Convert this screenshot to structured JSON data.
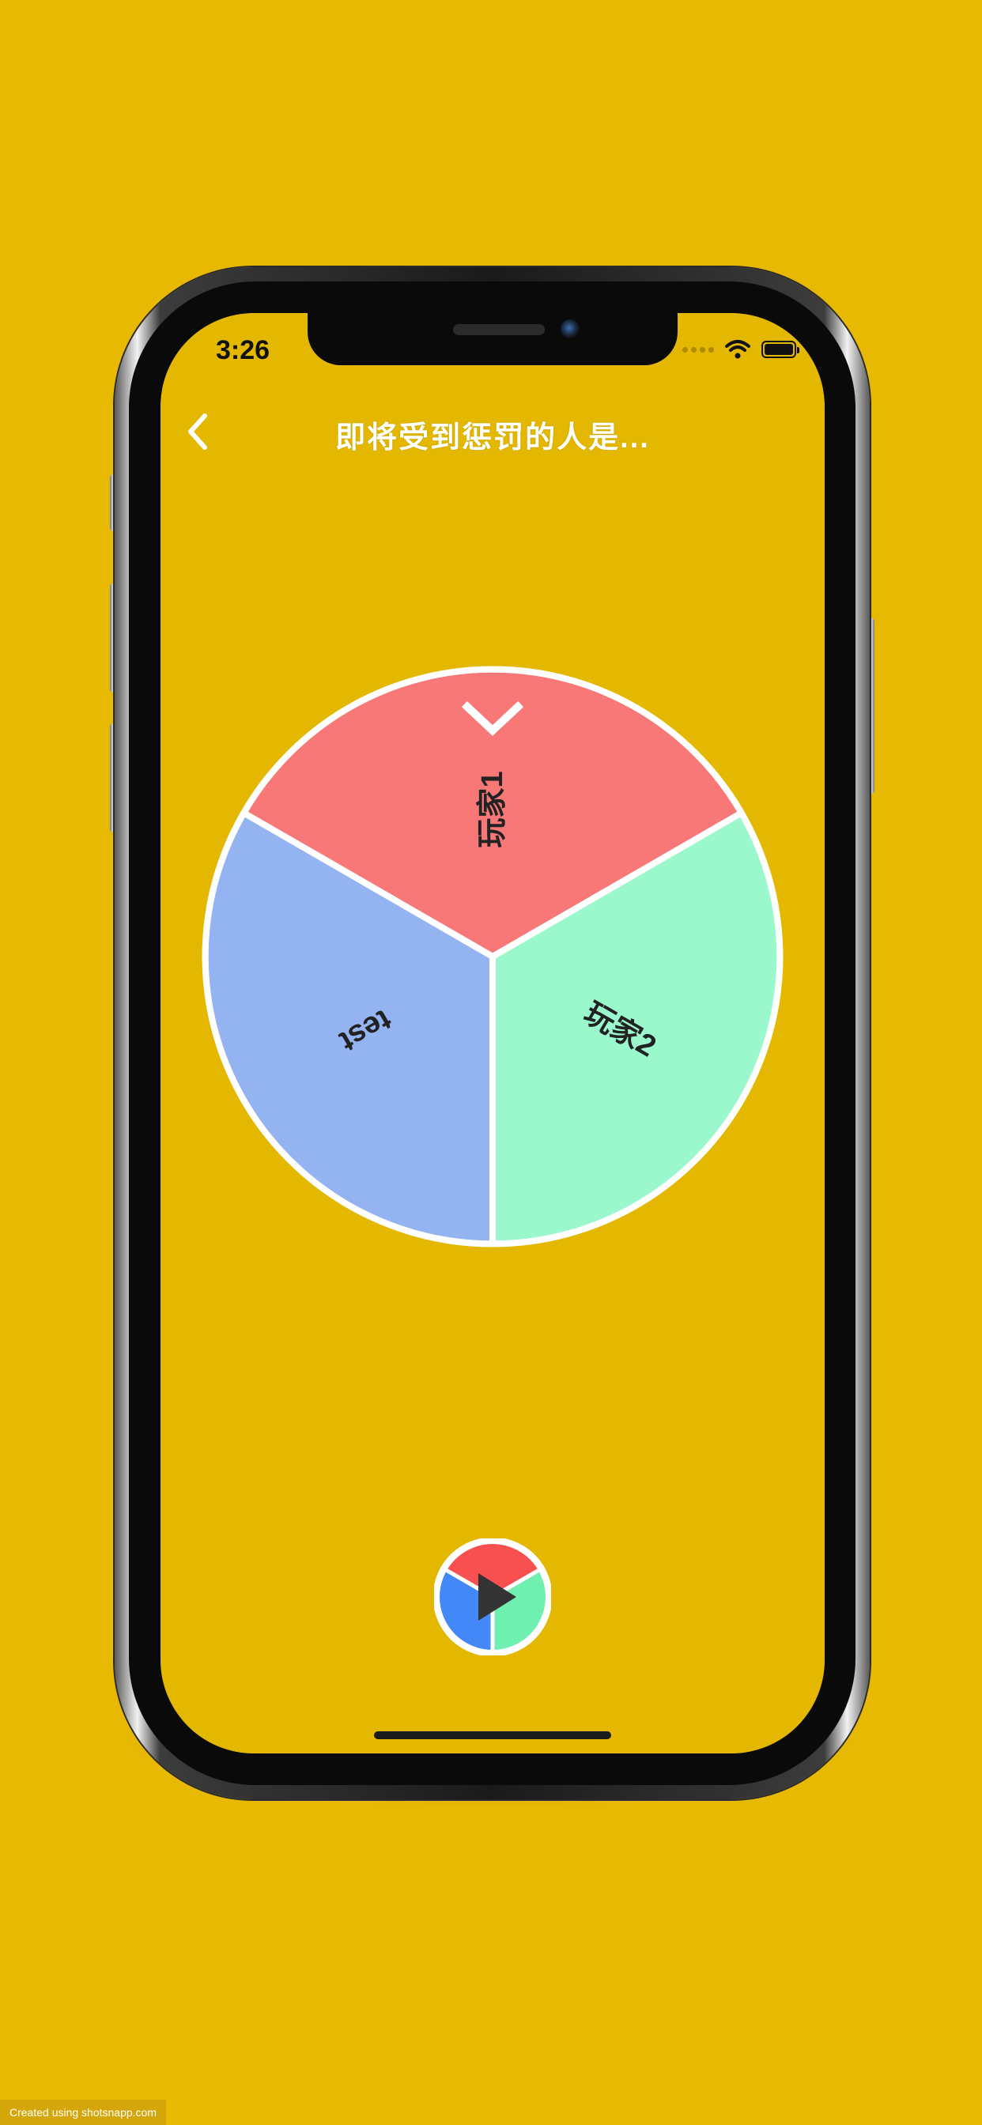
{
  "status_bar": {
    "time": "3:26",
    "wifi_icon": "wifi-icon",
    "battery_icon": "battery-icon"
  },
  "header": {
    "back_icon": "chevron-left-icon",
    "title": "即将受到惩罚的人是..."
  },
  "wheel": {
    "pointer_icon": "chevron-down-icon",
    "segments": [
      {
        "label": "玩家1",
        "color": "#F87878"
      },
      {
        "label": "玩家2",
        "color": "#9AF8CC"
      },
      {
        "label": "test",
        "color": "#93B4F0"
      }
    ]
  },
  "spin_button": {
    "icon": "play-icon",
    "colors": [
      "#F85050",
      "#70F0B0",
      "#4488F8"
    ]
  },
  "footer": {
    "credit": "Created using shotsnapp.com"
  },
  "colors": {
    "background": "#E8B903",
    "screen": "#E4B800",
    "title_text": "#FFFFFF"
  }
}
